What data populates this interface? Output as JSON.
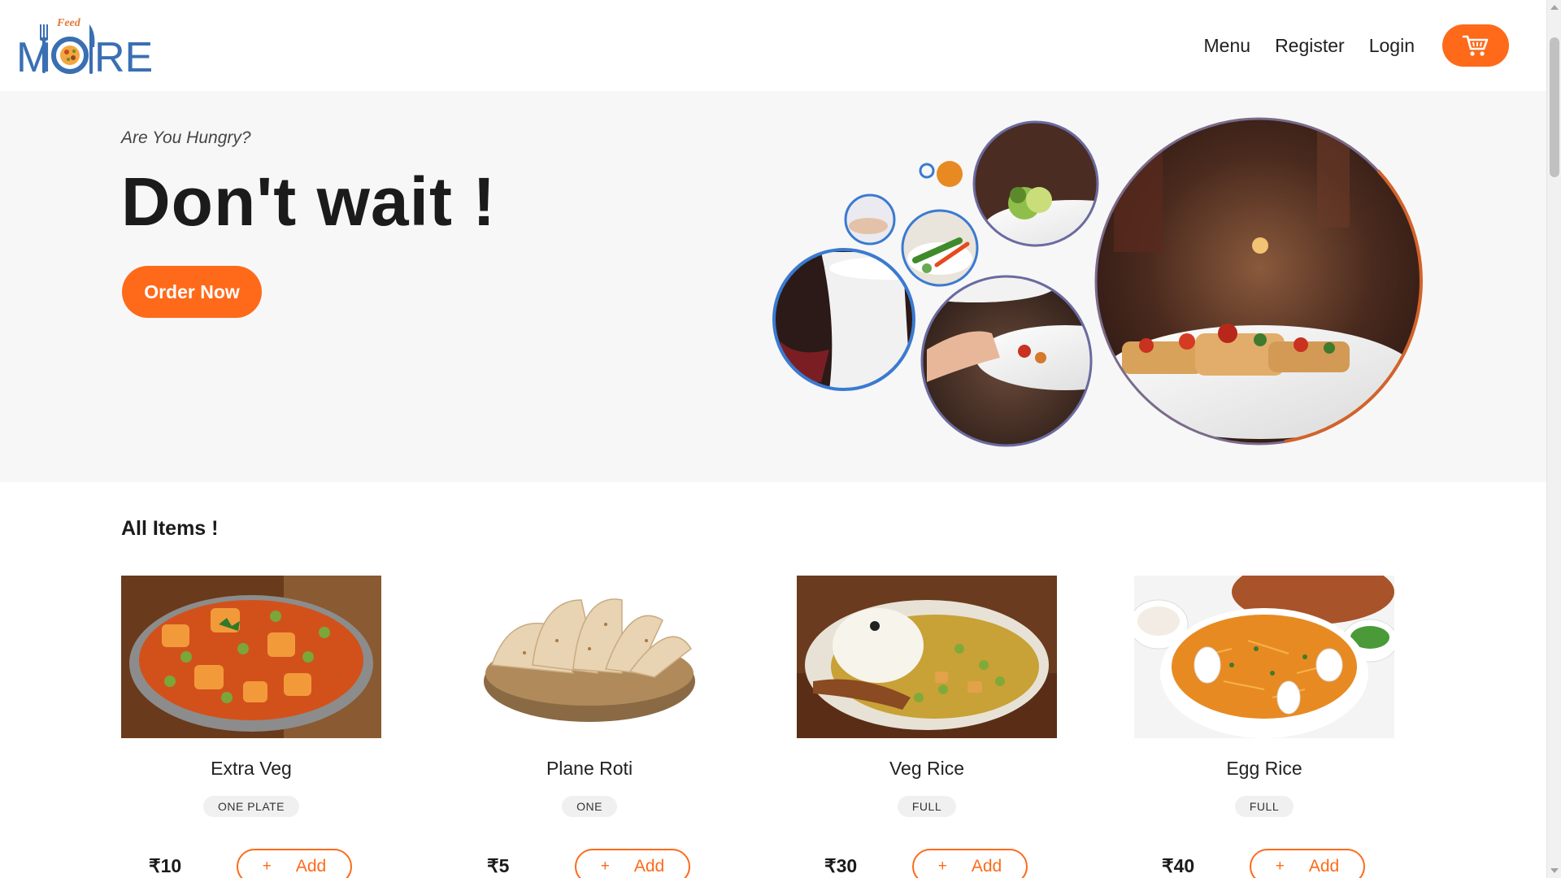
{
  "brand": {
    "logo_small": "Feed",
    "logo_main_left": "M",
    "logo_main_right": "RE"
  },
  "nav": {
    "menu": "Menu",
    "register": "Register",
    "login": "Login",
    "cart_icon": "cart-icon"
  },
  "hero": {
    "tagline": "Are You Hungry?",
    "title": "Don't wait !",
    "cta": "Order Now"
  },
  "items_section": {
    "title": "All Items !"
  },
  "items": [
    {
      "name": "Extra Veg",
      "size": "ONE PLATE",
      "price": "₹10",
      "add_label": "Add",
      "add_icon": "+"
    },
    {
      "name": "Plane Roti",
      "size": "ONE",
      "price": "₹5",
      "add_label": "Add",
      "add_icon": "+"
    },
    {
      "name": "Veg Rice",
      "size": "FULL",
      "price": "₹30",
      "add_label": "Add",
      "add_icon": "+"
    },
    {
      "name": "Egg Rice",
      "size": "FULL",
      "price": "₹40",
      "add_label": "Add",
      "add_icon": "+"
    }
  ],
  "colors": {
    "accent": "#fe6a1a",
    "logo_blue": "#3a6fb3",
    "hero_bg": "#f7f7f7"
  }
}
